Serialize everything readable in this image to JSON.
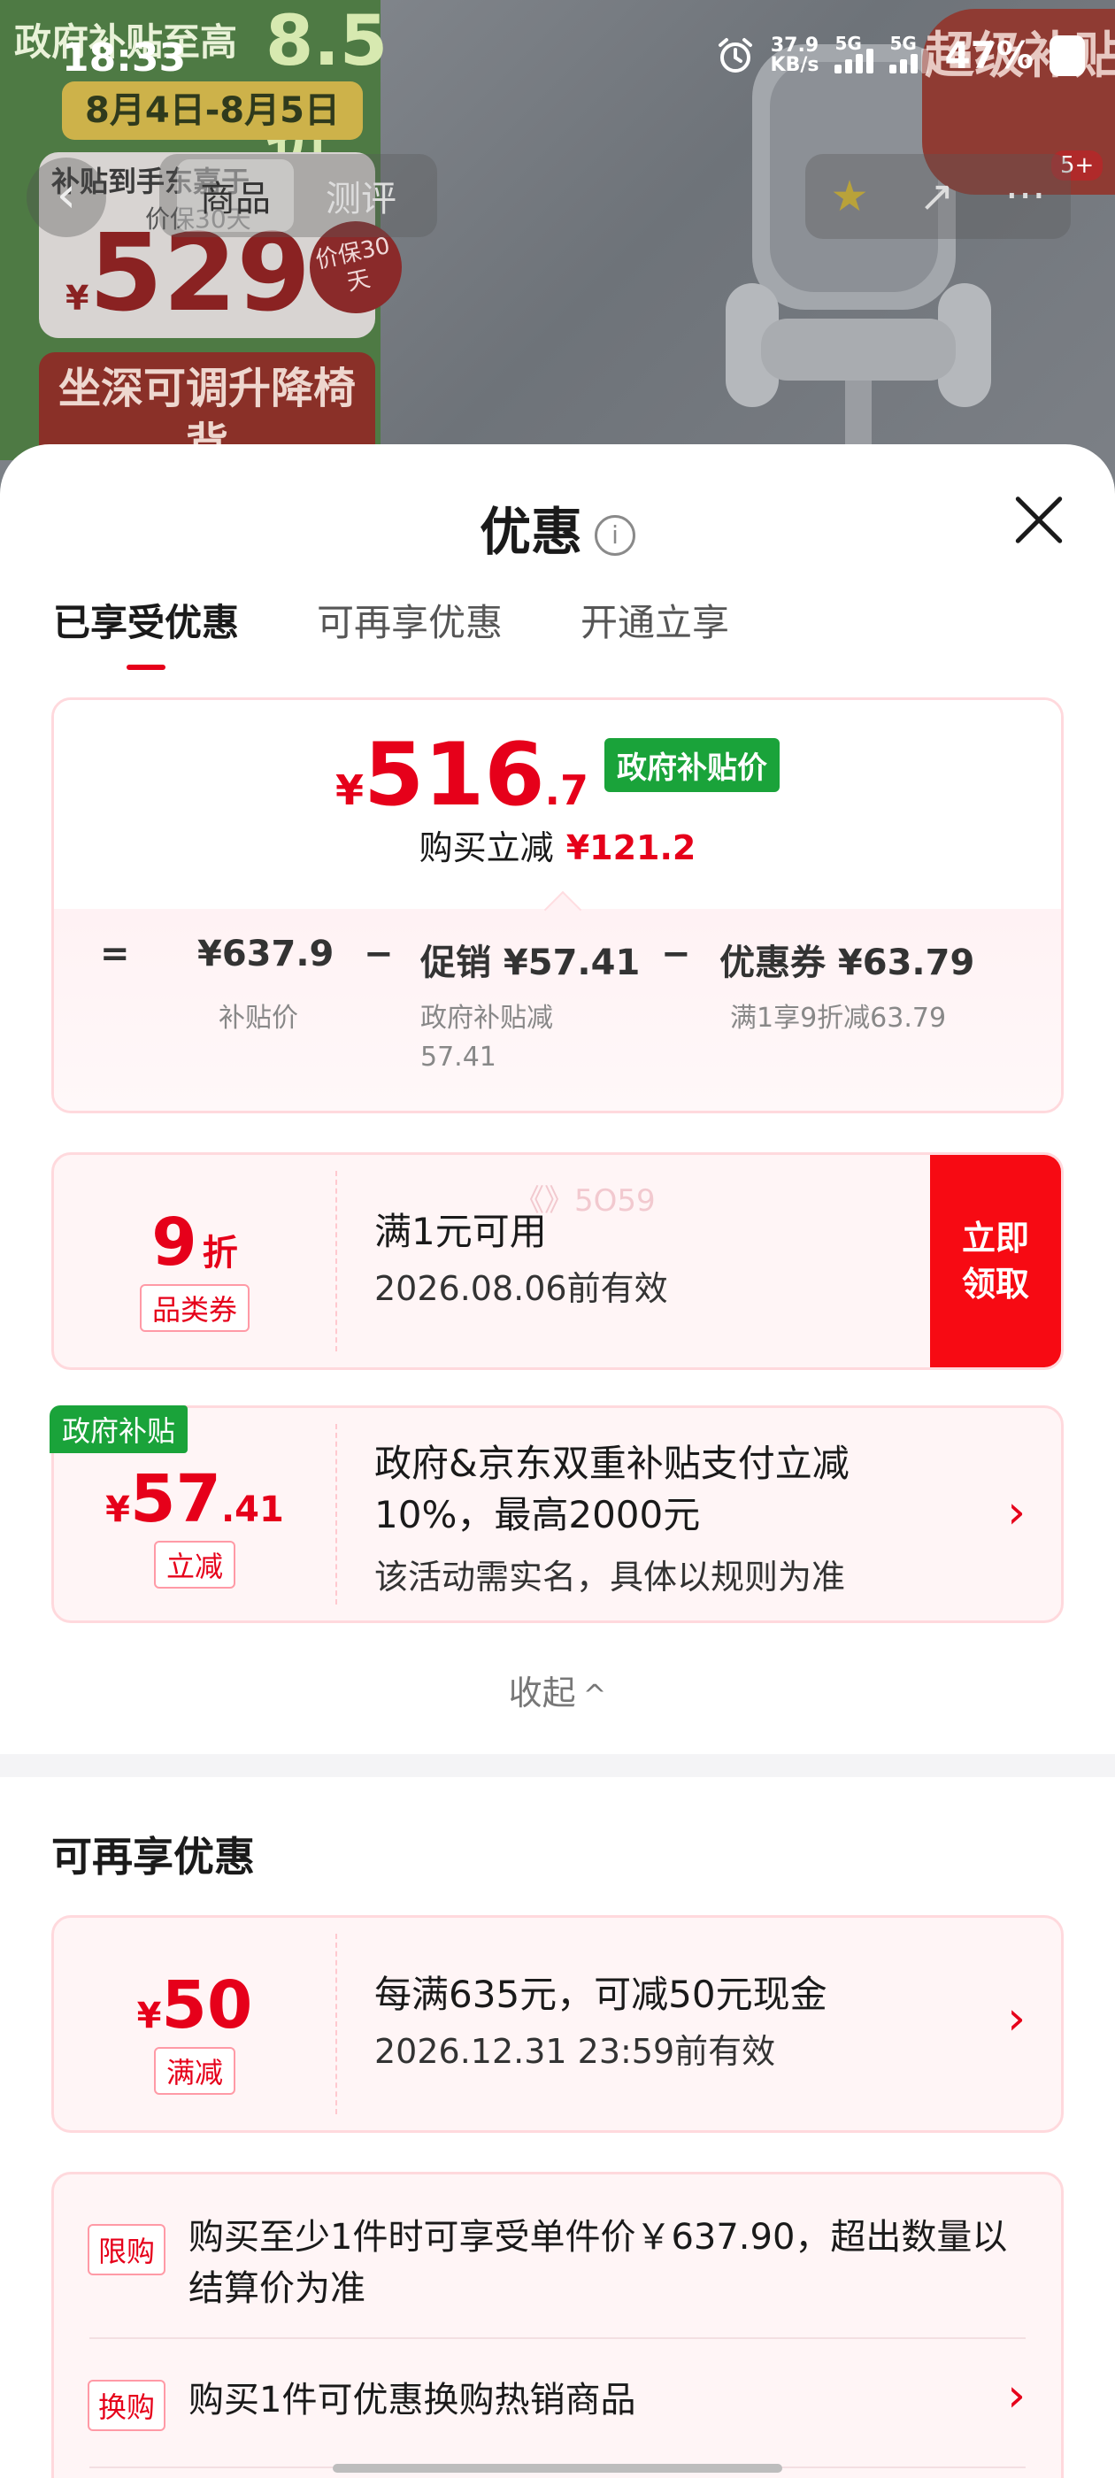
{
  "status_bar": {
    "time": "18:33",
    "net_speed_value": "37.9",
    "net_speed_unit": "KB/s",
    "network_1": "5G",
    "network_2": "5G",
    "battery": "47%"
  },
  "background": {
    "promo_line1": "政府补贴至高",
    "promo_discount": "8.5折",
    "promo_dates": "8月4日-8月5日",
    "promo_subsidy": "补贴到手东嘉于",
    "promo_guarantee_sub": "价保30天",
    "promo_currency": "¥",
    "promo_price": "529",
    "promo_badge": "价保30天",
    "promo_bottom": "坐深可调升降椅背",
    "super_badge": "超级补贴",
    "super_count": "5+",
    "nav_back": "‹",
    "nav_tabs": [
      "商品",
      "测评"
    ],
    "nav_star": "★",
    "nav_share": "↗",
    "nav_more": "···"
  },
  "sheet": {
    "title": "优惠",
    "info_icon_glyph": "i",
    "tabs": [
      "已享受优惠",
      "可再享优惠",
      "开通立享"
    ],
    "summary": {
      "currency": "¥",
      "price_int": "516",
      "price_dec": ".7",
      "price_tag": "政府补贴价",
      "save_label": "购买立减",
      "save_amount": "¥121.2",
      "eq": "=",
      "base_price": "¥637.9",
      "base_label": "补贴价",
      "minus1": "−",
      "promo_item": "促销 ¥57.41",
      "promo_sub1": "政府补贴减",
      "promo_sub2": "57.41",
      "minus2": "−",
      "coupon_item": "优惠券 ¥63.79",
      "coupon_sub": "满1享9折减63.79"
    },
    "coupon1": {
      "value": "9",
      "unit": "折",
      "label": "品类券",
      "watermark": "《》5O59",
      "text": "满1元可用",
      "sub": "2026.08.06前有效",
      "claim": [
        "立即",
        "领取"
      ]
    },
    "coupon2": {
      "corner": "政府补贴",
      "currency": "¥",
      "value_int": "57",
      "value_dec": ".41",
      "label": "立减",
      "text_line1": "政府&京东双重补贴支付立减",
      "text_line2": "10%，最高2000元",
      "sub": "该活动需实名，具体以规则为准",
      "arrow": "›"
    },
    "collapse": "收起",
    "collapse_chevron": "^",
    "section_title": "可再享优惠",
    "coupon3": {
      "currency": "¥",
      "value": "50",
      "label": "满减",
      "text": "每满635元，可减50元现金",
      "sub": "2026.12.31 23:59前有效",
      "arrow": "›"
    },
    "rules": [
      {
        "tag": "限购",
        "text": "购买至少1件时可享受单件价￥637.90，超出数量以结算价为准"
      },
      {
        "tag": "换购",
        "text": "购买1件可优惠换购热销商品",
        "arrow": "›"
      }
    ]
  },
  "colors": {
    "accent_red": "#e6001a",
    "claim_red": "#f70a13",
    "gov_green": "#1aa33a"
  }
}
